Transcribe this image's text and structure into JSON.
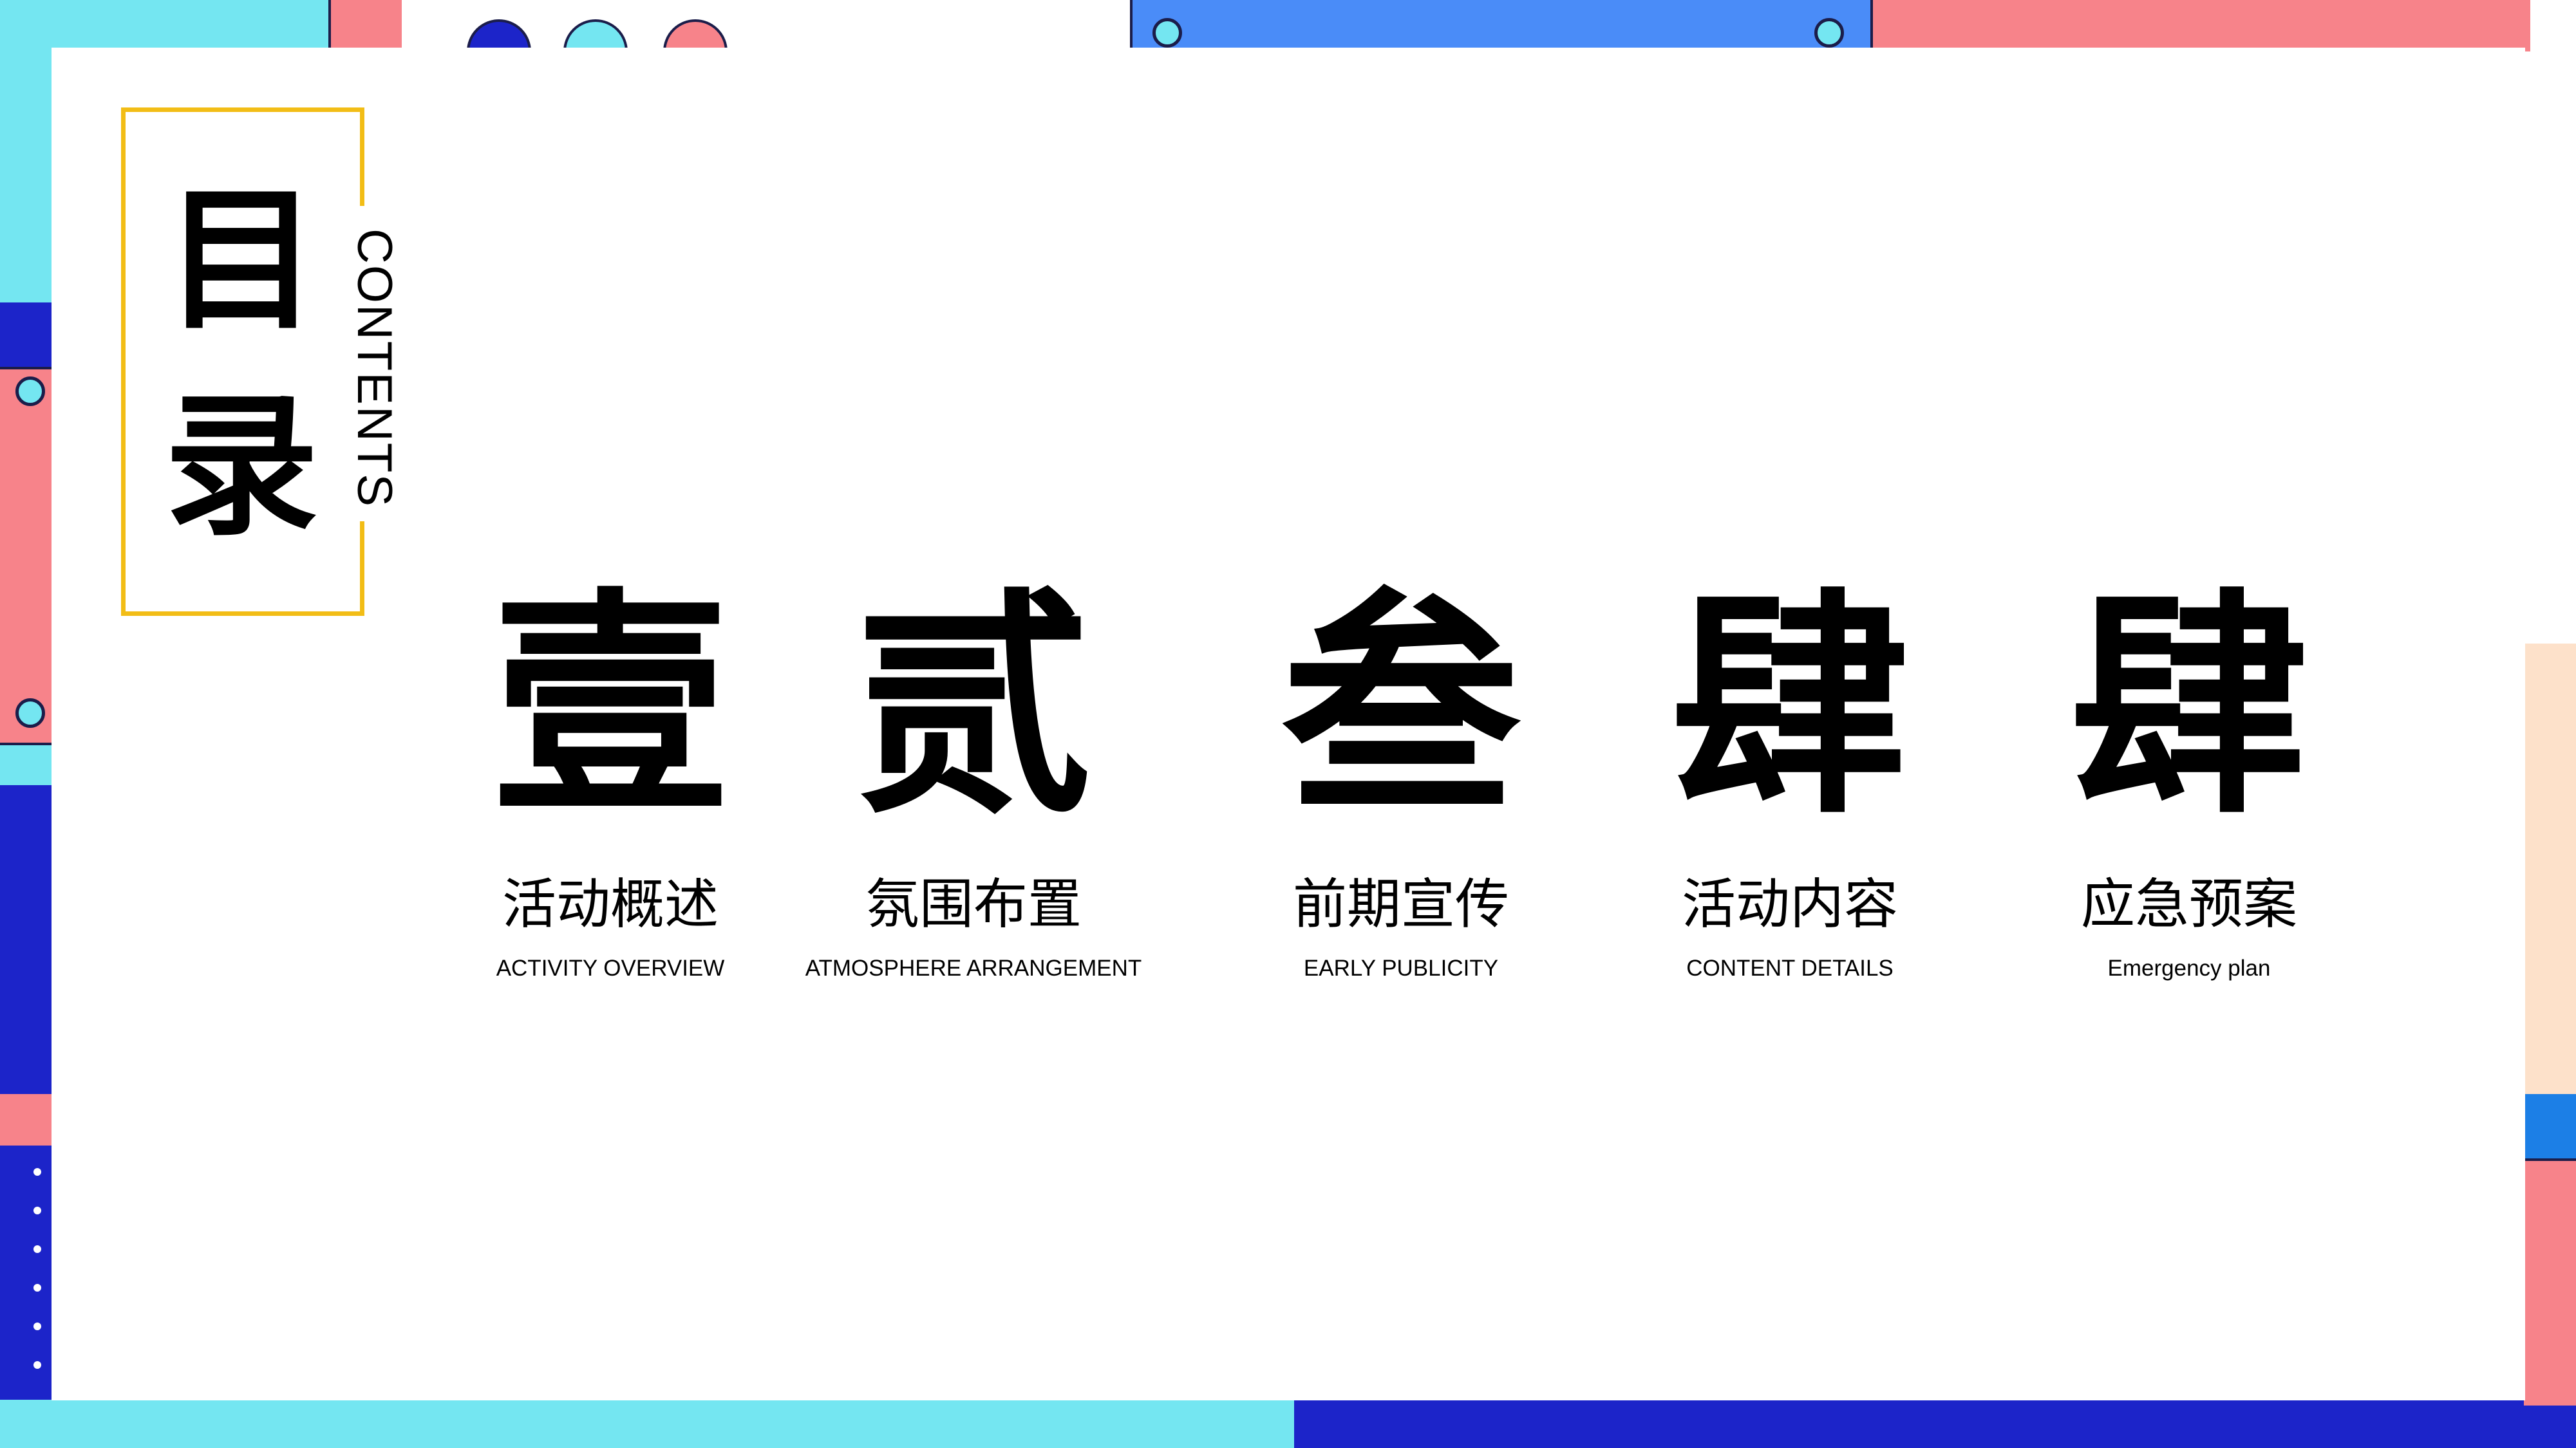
{
  "slide": {
    "title_cn": "目录",
    "title_cn_chars": [
      "目",
      "录"
    ],
    "title_en": "CONTENTS"
  },
  "items": [
    {
      "number": "壹",
      "title": "活动概述",
      "subtitle": "ACTIVITY OVERVIEW"
    },
    {
      "number": "贰",
      "title": "氛围布置",
      "subtitle": "ATMOSPHERE ARRANGEMENT"
    },
    {
      "number": "叁",
      "title": "前期宣传",
      "subtitle": "EARLY PUBLICITY"
    },
    {
      "number": "肆",
      "title": "活动内容",
      "subtitle": "CONTENT DETAILS"
    },
    {
      "number": "肆",
      "title": "应急预案",
      "subtitle": "Emergency plan"
    }
  ],
  "colors": {
    "accent_yellow": "#f2bd16",
    "cyan": "#74e6f1",
    "pink": "#f7838a",
    "royal_blue": "#1c24c9",
    "sky_blue": "#4a8cf8",
    "peach": "#fde1ca",
    "outline": "#1b1d4a"
  }
}
